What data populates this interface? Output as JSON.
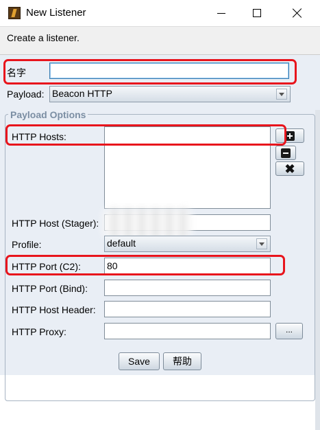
{
  "window": {
    "title": "New Listener",
    "icon": "app-icon"
  },
  "description": "Create a listener.",
  "form": {
    "name_label": "名字",
    "name_value": "",
    "payload_label": "Payload:",
    "payload_value": "Beacon HTTP",
    "options_legend": "Payload Options",
    "hosts_label": "HTTP Hosts:",
    "stager_label": "HTTP Host (Stager):",
    "profile_label": "Profile:",
    "profile_value": "default",
    "port_c2_label": "HTTP Port (C2):",
    "port_c2_value": "80",
    "port_bind_label": "HTTP Port (Bind):",
    "port_bind_value": "",
    "host_header_label": "HTTP Host Header:",
    "host_header_value": "",
    "proxy_label": "HTTP Proxy:",
    "proxy_value": "",
    "proxy_button": "..."
  },
  "buttons": {
    "save": "Save",
    "help": "帮助"
  },
  "annotations": {
    "highlight_color": "#e8141c"
  },
  "icons": [
    "app-icon",
    "minimize-icon",
    "maximize-icon",
    "close-icon",
    "plus-icon",
    "minus-icon",
    "remove-icon",
    "dropdown-arrow-icon"
  ]
}
